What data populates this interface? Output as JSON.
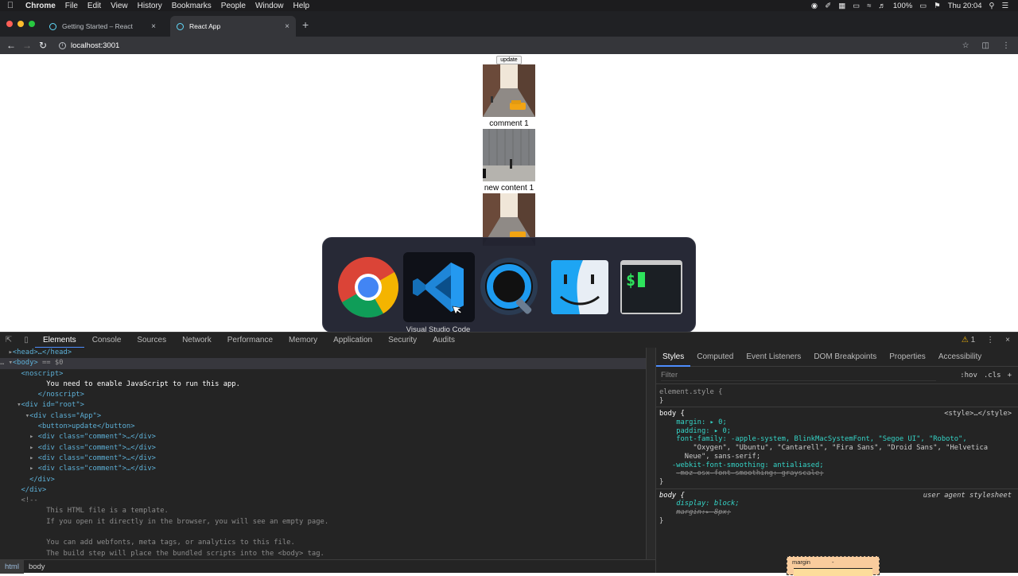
{
  "menubar": {
    "app_name": "Chrome",
    "items": [
      "File",
      "Edit",
      "View",
      "History",
      "Bookmarks",
      "People",
      "Window",
      "Help"
    ],
    "battery": "100%",
    "clock": "Thu 20:04"
  },
  "tabs": [
    {
      "label": "Getting Started – React",
      "active": false
    },
    {
      "label": "React App",
      "active": true
    }
  ],
  "address": {
    "url": "localhost:3001"
  },
  "page": {
    "update_button": "update",
    "captions": [
      "comment 1",
      "new content 1"
    ]
  },
  "switcher": {
    "apps": [
      {
        "name": "Google Chrome",
        "icon": "chrome-icon"
      },
      {
        "name": "Visual Studio Code",
        "icon": "vscode-icon"
      },
      {
        "name": "QuickTime Player",
        "icon": "quicktime-icon"
      },
      {
        "name": "Finder",
        "icon": "finder-icon"
      },
      {
        "name": "Terminal",
        "icon": "terminal-icon"
      }
    ],
    "selected_label": "Visual Studio Code"
  },
  "devtools": {
    "tabs": [
      "Elements",
      "Console",
      "Sources",
      "Network",
      "Performance",
      "Memory",
      "Application",
      "Security",
      "Audits"
    ],
    "warning_count": "1",
    "dom": {
      "head": "<head>…</head>",
      "body_open": "<body>",
      "body_marker": "== $0",
      "noscript_open": "<noscript>",
      "noscript_text": "You need to enable JavaScript to run this app.",
      "noscript_close": "</noscript>",
      "root_div": "<div id=\"root\">",
      "app_div": "<div class=\"App\">",
      "button_line": "<button>update</button>",
      "comment_divs": [
        "<div class=\"comment\">…</div>",
        "<div class=\"comment\">…</div>",
        "<div class=\"comment\">…</div>",
        "<div class=\"comment\">…</div>"
      ],
      "div_close_1": "</div>",
      "div_close_2": "</div>",
      "comment_start": "<!--",
      "comment_lines": [
        "This HTML file is a template.",
        "If you open it directly in the browser, you will see an empty page.",
        "",
        "You can add webfonts, meta tags, or analytics to this file.",
        "The build step will place the bundled scripts into the <body> tag."
      ]
    },
    "breadcrumbs": [
      "html",
      "body"
    ],
    "side_tabs": [
      "Styles",
      "Computed",
      "Event Listeners",
      "DOM Breakpoints",
      "Properties",
      "Accessibility"
    ],
    "filter_placeholder": "Filter",
    "filter_buttons": [
      ":hov",
      ".cls",
      "+"
    ],
    "styles": {
      "element_style": "element.style {",
      "close": "}",
      "body_rule_selector": "body {",
      "body_rule_source": "<style>…</style>",
      "margin": "margin: ▸ 0;",
      "padding": "padding: ▸ 0;",
      "font_family_1": "font-family: -apple-system, BlinkMacSystemFont, \"Segoe UI\", \"Roboto\",",
      "font_family_2": "\"Oxygen\", \"Ubuntu\", \"Cantarell\", \"Fira Sans\", \"Droid Sans\", \"Helvetica",
      "font_family_3": "Neue\", sans-serif;",
      "webkit_smoothing": "-webkit-font-smoothing: antialiased;",
      "moz_smoothing": "-moz-osx-font-smoothing: grayscale;",
      "ua_selector": "body {",
      "ua_source": "user agent stylesheet",
      "display": "display: block;",
      "ua_margin": "margin:▸ 8px;",
      "box_label": "margin",
      "box_dash": "-"
    }
  }
}
